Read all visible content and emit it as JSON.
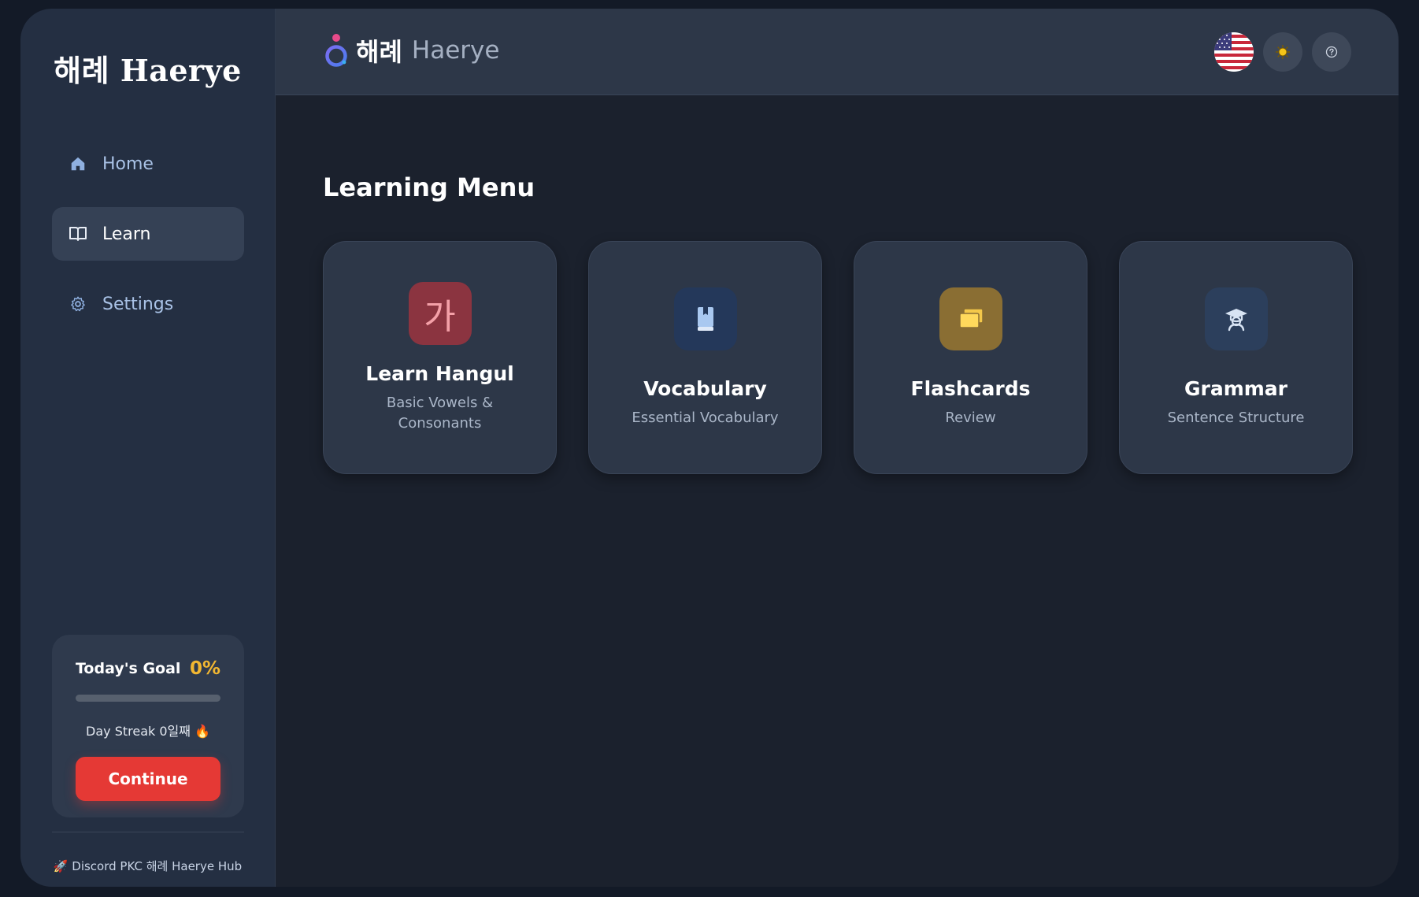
{
  "sidebar": {
    "brand": "해례 Haerye",
    "nav": [
      {
        "label": "Home",
        "icon": "home-icon",
        "active": false
      },
      {
        "label": "Learn",
        "icon": "book-open-icon",
        "active": true
      },
      {
        "label": "Settings",
        "icon": "gear-icon",
        "active": false
      }
    ],
    "goal": {
      "title": "Today's Goal",
      "percent_text": "0%",
      "progress": 0,
      "streak": "Day Streak 0일째 🔥",
      "button": "Continue"
    },
    "footer": "🚀 Discord PKC 해례 Haerye Hub"
  },
  "header": {
    "logo_ko": "해례",
    "logo_en": "Haerye",
    "actions": [
      {
        "name": "language-flag-us",
        "icon": "us-flag-icon"
      },
      {
        "name": "theme-toggle",
        "icon": "sun-icon"
      },
      {
        "name": "help",
        "icon": "help-icon"
      }
    ]
  },
  "main": {
    "title": "Learning Menu",
    "cards": [
      {
        "title": "Learn Hangul",
        "subtitle": "Basic Vowels & Consonants",
        "icon_text": "가",
        "icon": "hangul-icon",
        "color": "#8b3440"
      },
      {
        "title": "Vocabulary",
        "subtitle": "Essential Vocabulary",
        "icon": "book-icon",
        "color": "#24385a"
      },
      {
        "title": "Flashcards",
        "subtitle": "Review",
        "icon": "cards-icon",
        "color": "#8a6e33"
      },
      {
        "title": "Grammar",
        "subtitle": "Sentence Structure",
        "icon": "graduation-cap-icon",
        "color": "#2c3f5c"
      }
    ]
  },
  "colors": {
    "accent": "#e53935",
    "goal": "#f2b731",
    "sidebar": "#242f42",
    "topbar": "#2d3748"
  }
}
